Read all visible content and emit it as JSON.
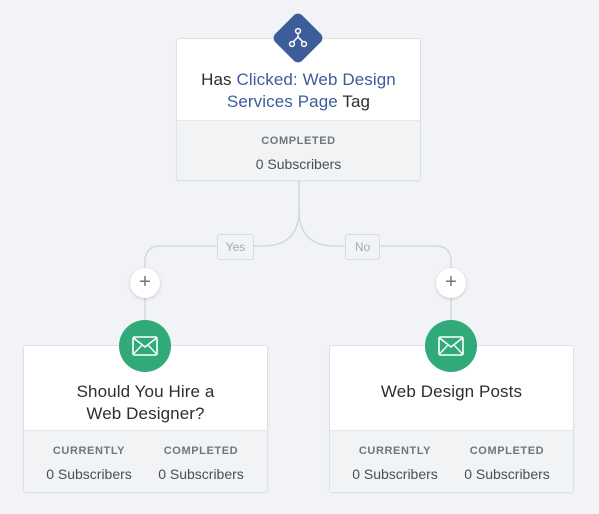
{
  "condition_step": {
    "icon": "branch-icon",
    "title_prefix": "Has ",
    "title_link": "Clicked: Web Design Services Page",
    "title_suffix": " Tag",
    "stat_label": "COMPLETED",
    "stat_value": "0 Subscribers"
  },
  "branches": {
    "yes_label": "Yes",
    "no_label": "No",
    "add_symbol": "+"
  },
  "email_steps": [
    {
      "icon": "envelope-icon",
      "title": "Should You Hire a Web Designer?",
      "currently_label": "CURRENTLY",
      "currently_value": "0 Subscribers",
      "completed_label": "COMPLETED",
      "completed_value": "0 Subscribers"
    },
    {
      "icon": "envelope-icon",
      "title": "Web Design Posts",
      "currently_label": "CURRENTLY",
      "currently_value": "0 Subscribers",
      "completed_label": "COMPLETED",
      "completed_value": "0 Subscribers"
    }
  ],
  "colors": {
    "background": "#f1f3f6",
    "condition_accent": "#3d5c9a",
    "email_accent": "#2faa78",
    "connector": "#d4d8dd"
  }
}
